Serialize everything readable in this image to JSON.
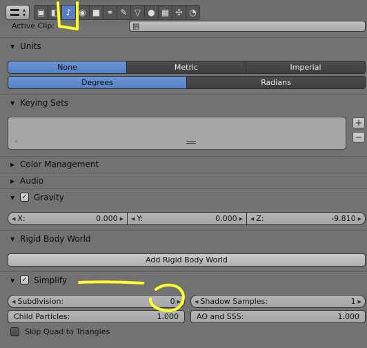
{
  "header": {
    "editor_icon": "properties-editor-icon",
    "context_tabs": [
      {
        "icon": "render-icon",
        "glyph": "▣",
        "active": false
      },
      {
        "icon": "render-layers-icon",
        "glyph": "◧",
        "active": false
      },
      {
        "icon": "scene-icon",
        "glyph": "♪",
        "active": true
      },
      {
        "icon": "world-icon",
        "glyph": "◉",
        "active": false
      },
      {
        "icon": "object-icon",
        "glyph": "■",
        "active": false
      },
      {
        "icon": "constraints-icon",
        "glyph": "⚭",
        "active": false
      },
      {
        "icon": "modifiers-icon",
        "glyph": "✎",
        "active": false
      },
      {
        "icon": "data-icon",
        "glyph": "▽",
        "active": false
      },
      {
        "icon": "material-icon",
        "glyph": "●",
        "active": false
      },
      {
        "icon": "texture-icon",
        "glyph": "▦",
        "active": false
      },
      {
        "icon": "particles-icon",
        "glyph": "✣",
        "active": false
      },
      {
        "icon": "physics-icon",
        "glyph": "◔",
        "active": false
      }
    ]
  },
  "active_clip": {
    "label": "Active Clip:",
    "icon": "movie-clip-icon"
  },
  "units": {
    "title": "Units",
    "system": {
      "options": [
        "None",
        "Metric",
        "Imperial"
      ],
      "selected": "None"
    },
    "rotation": {
      "options": [
        "Degrees",
        "Radians"
      ],
      "selected": "Degrees"
    }
  },
  "keying_sets": {
    "title": "Keying Sets",
    "add": "+",
    "remove": "−"
  },
  "color_management": {
    "title": "Color Management"
  },
  "audio": {
    "title": "Audio"
  },
  "gravity": {
    "title": "Gravity",
    "enabled": true,
    "x": {
      "label": "X:",
      "value": "0.000"
    },
    "y": {
      "label": "Y:",
      "value": "0.000"
    },
    "z": {
      "label": "Z:",
      "value": "-9.810"
    }
  },
  "rigid_body_world": {
    "title": "Rigid Body World",
    "button": "Add Rigid Body World"
  },
  "simplify": {
    "title": "Simplify",
    "enabled": true,
    "subdivision": {
      "label": "Subdivision:",
      "value": "0"
    },
    "shadow_samples": {
      "label": "Shadow Samples:",
      "value": "1"
    },
    "child_particles": {
      "label": "Child Particles:",
      "value": "1.000"
    },
    "ao_sss": {
      "label": "AO and SSS:",
      "value": "1.000"
    },
    "skip_quad": {
      "label": "Skip Quad to Triangles",
      "checked": false
    }
  },
  "annotation_color": "#ffff2a",
  "checkmark": "✓"
}
